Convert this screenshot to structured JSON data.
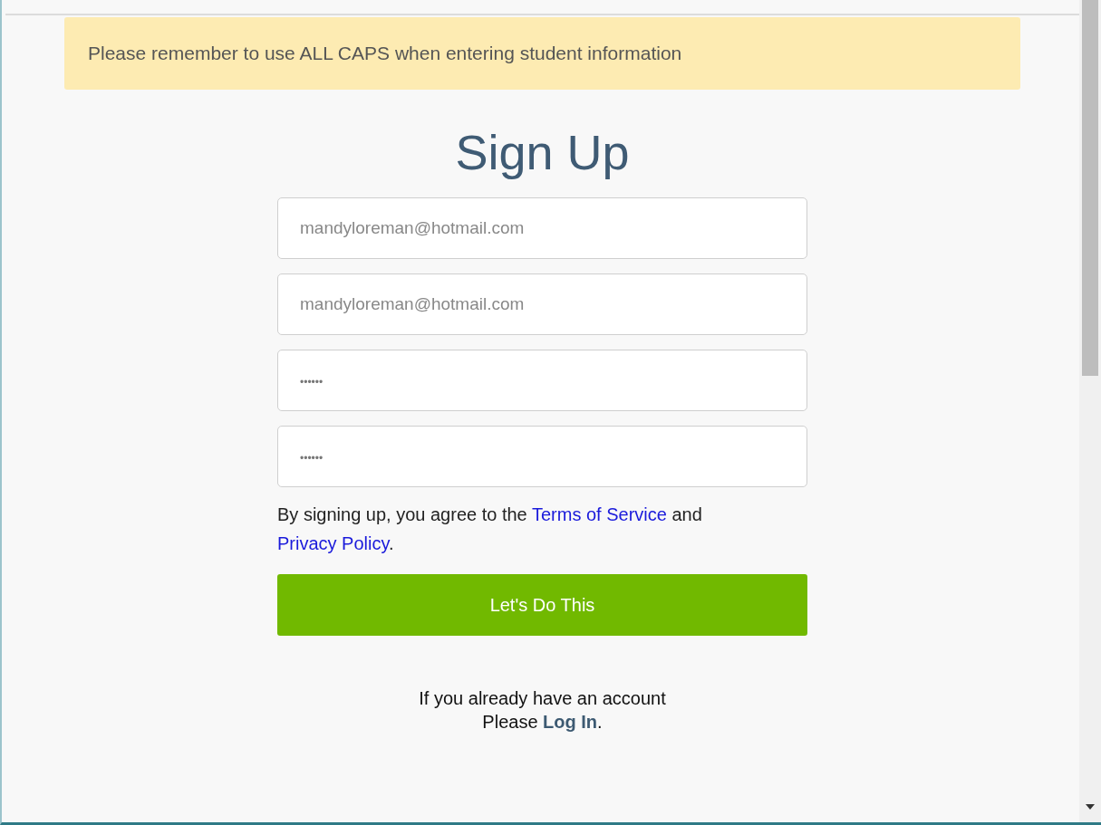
{
  "notice": "Please remember to use ALL CAPS when entering student information",
  "title": "Sign Up",
  "fields": [
    {
      "placeholder": "mandyloreman@hotmail.com",
      "kind": "text"
    },
    {
      "placeholder": "mandyloreman@hotmail.com",
      "kind": "text"
    },
    {
      "placeholder": "••••••",
      "kind": "secret"
    },
    {
      "placeholder": "••••••",
      "kind": "secret"
    }
  ],
  "terms": {
    "before": "By signing up, you agree to the",
    "terms_link": "Terms of Service",
    "middle": "and",
    "privacy_link": "Privacy Policy",
    "after": "."
  },
  "submit": "Let's Do This",
  "login": {
    "line1": "If you already have an account",
    "before": "Please",
    "link": "Log In",
    "after": "."
  }
}
